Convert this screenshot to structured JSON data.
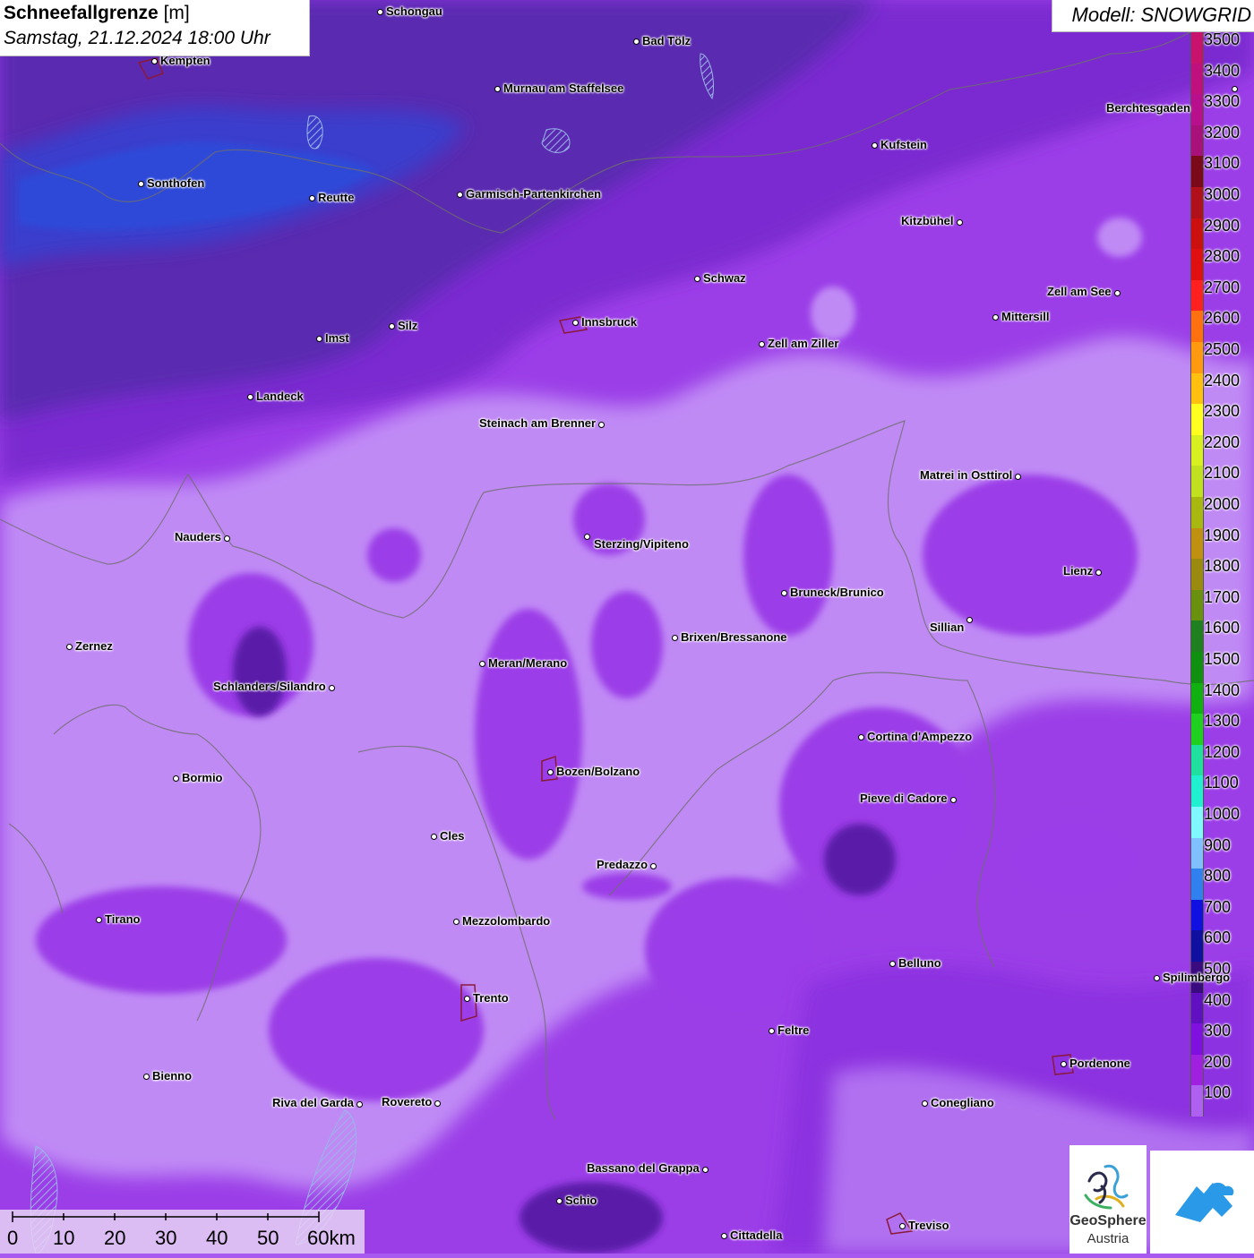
{
  "header": {
    "title_bold": "Schneefallgrenze",
    "title_unit": "[m]",
    "date": "Samstag, 21.12.2024 18:00 Uhr",
    "model": "Modell: SNOWGRID"
  },
  "legend": {
    "levels": [
      "3500",
      "3400",
      "3300",
      "3200",
      "3100",
      "3000",
      "2900",
      "2800",
      "2700",
      "2600",
      "2500",
      "2400",
      "2300",
      "2200",
      "2100",
      "2000",
      "1900",
      "1800",
      "1700",
      "1600",
      "1500",
      "1400",
      "1300",
      "1200",
      "1100",
      "1000",
      "900",
      "800",
      "700",
      "600",
      "500",
      "400",
      "300",
      "200",
      "100"
    ],
    "colors": [
      "#c8136e",
      "#c0107e",
      "#b80f8c",
      "#a8107a",
      "#7a0a1a",
      "#b0101a",
      "#cc1010",
      "#e01010",
      "#ff2020",
      "#ff7010",
      "#ff9a10",
      "#ffc010",
      "#ffff20",
      "#d8f020",
      "#c0e020",
      "#a8b810",
      "#c09010",
      "#9a8a10",
      "#6a9010",
      "#208020",
      "#109010",
      "#10b010",
      "#20d020",
      "#20e0a0",
      "#20f0d0",
      "#80f8ff",
      "#80c0ff",
      "#3080f0",
      "#1010e0",
      "#1010a0",
      "#3a0a80",
      "#6010c0",
      "#8010e0",
      "#a020e0",
      "#b060f0"
    ]
  },
  "cities": [
    {
      "name": "Schongau"
    },
    {
      "name": "Bad Tölz"
    },
    {
      "name": "Kempten"
    },
    {
      "name": "Murnau am Staffelsee"
    },
    {
      "name": "Berchtesgaden"
    },
    {
      "name": "Kufstein"
    },
    {
      "name": "Sonthofen"
    },
    {
      "name": "Reutte"
    },
    {
      "name": "Garmisch-Partenkirchen"
    },
    {
      "name": "Kitzbühel"
    },
    {
      "name": "Schwaz"
    },
    {
      "name": "Zell am See"
    },
    {
      "name": "Innsbruck"
    },
    {
      "name": "Mittersill"
    },
    {
      "name": "Imst"
    },
    {
      "name": "Silz"
    },
    {
      "name": "Zell am Ziller"
    },
    {
      "name": "Landeck"
    },
    {
      "name": "Steinach am Brenner"
    },
    {
      "name": "Matrei in Osttirol"
    },
    {
      "name": "Nauders"
    },
    {
      "name": "Sterzing/Vipiteno"
    },
    {
      "name": "Lienz"
    },
    {
      "name": "Bruneck/Brunico"
    },
    {
      "name": "Sillian"
    },
    {
      "name": "Zernez"
    },
    {
      "name": "Brixen/Bressanone"
    },
    {
      "name": "Meran/Merano"
    },
    {
      "name": "Schlanders/Silandro"
    },
    {
      "name": "Cortina d'Ampezzo"
    },
    {
      "name": "Bozen/Bolzano"
    },
    {
      "name": "Bormio"
    },
    {
      "name": "Pieve di Cadore"
    },
    {
      "name": "Cles"
    },
    {
      "name": "Predazzo"
    },
    {
      "name": "Tirano"
    },
    {
      "name": "Mezzolombardo"
    },
    {
      "name": "Belluno"
    },
    {
      "name": "Spilimbergo"
    },
    {
      "name": "Trento"
    },
    {
      "name": "Feltre"
    },
    {
      "name": "Pordenone"
    },
    {
      "name": "Bienno"
    },
    {
      "name": "Riva del Garda"
    },
    {
      "name": "Rovereto"
    },
    {
      "name": "Conegliano"
    },
    {
      "name": "Bassano del Grappa"
    },
    {
      "name": "Schio"
    },
    {
      "name": "Treviso"
    },
    {
      "name": "Cittadella"
    }
  ],
  "scale": {
    "ticks": [
      "0",
      "10",
      "20",
      "30",
      "40",
      "50",
      "60km"
    ]
  },
  "logo": {
    "name_line1": "GeoSphere",
    "name_line2": "Austria"
  }
}
